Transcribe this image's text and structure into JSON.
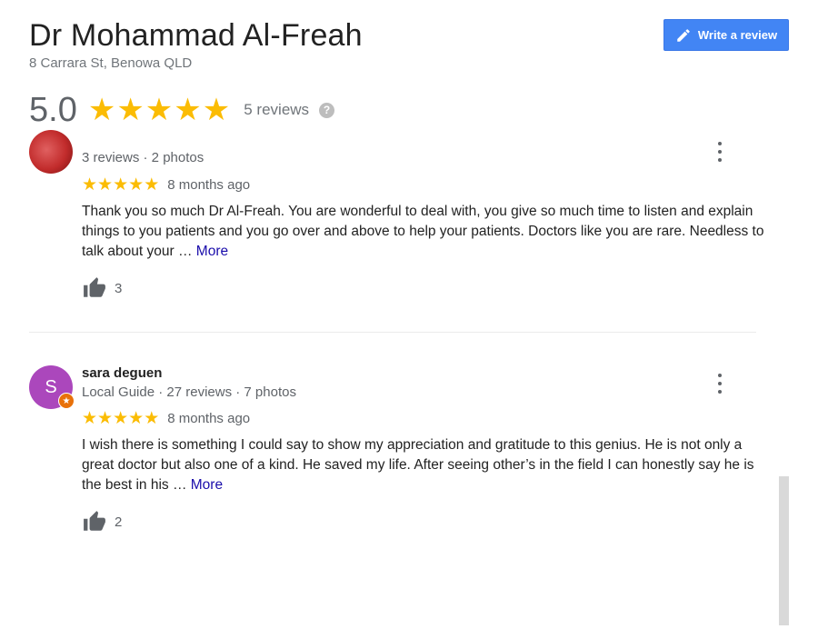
{
  "place": {
    "name": "Dr Mohammad Al-Freah",
    "address": "8 Carrara St, Benowa QLD"
  },
  "actions": {
    "write_review_label": "Write a review"
  },
  "summary": {
    "score": "5.0",
    "stars": 5,
    "review_count": "5 reviews",
    "help_glyph": "?"
  },
  "reviews": [
    {
      "name": "",
      "meta": "3 reviews · 2 photos",
      "rating": 5,
      "age": "8 months ago",
      "text": "Thank you so much Dr Al-Freah. You are wonderful to deal with, you give so much time to listen and explain things to you patients and you go over and above to help your patients. Doctors like you are rare. Needless to talk about your …",
      "more": "More",
      "likes": "3"
    },
    {
      "name": "sara deguen",
      "avatar_letter": "S",
      "badge_glyph": "★",
      "meta": "Local Guide · 27 reviews · 7 photos",
      "rating": 5,
      "age": "8 months ago",
      "text": "I wish there is something I could say to show my appreciation and gratitude to this genius. He is not only a great doctor but also one of a kind. He saved my life. After seeing other’s in the field I can honestly say he is the best in his …",
      "more": "More",
      "likes": "2"
    }
  ],
  "icons": {
    "write": "pencil-icon",
    "help": "help-icon",
    "like": "thumbs-up-icon",
    "menu": "more-vert-icon",
    "local_guide": "local-guide-badge-icon"
  },
  "colors": {
    "star": "#fbbc04",
    "button": "#4285f4",
    "link": "#1a0dab",
    "avatar_s": "#ab47bc",
    "badge": "#e8710a"
  },
  "star_glyph": "★"
}
